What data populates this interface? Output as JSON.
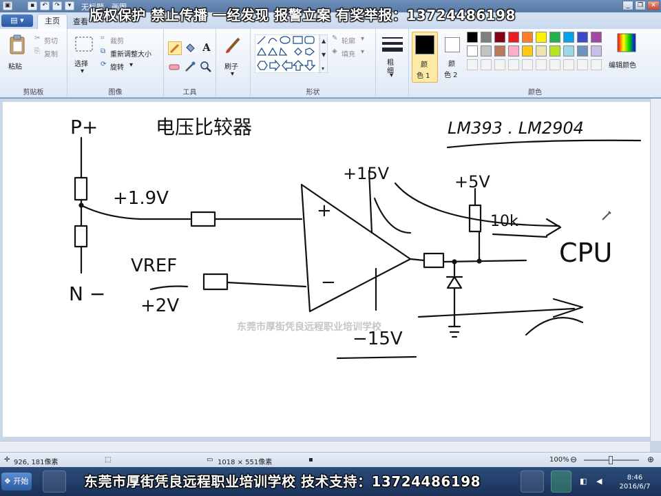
{
  "window": {
    "title": "无标题 - 画图"
  },
  "watermark": {
    "top": "版权保护  禁止传播  一经发现  报警立案  有奖举报：13724486198",
    "bottom": "东莞市厚街凭良远程职业培训学校  技术支持：13724486198",
    "center": "东莞市厚街凭良远程职业培训学校"
  },
  "tabs": {
    "menu": "▤ ▾",
    "home": "主页",
    "view": "查看"
  },
  "ribbon": {
    "clipboard": {
      "paste": "粘贴",
      "cut": "剪切",
      "copy": "复制",
      "label": "剪贴板"
    },
    "image": {
      "select": "选择",
      "crop": "裁剪",
      "resize": "重新调整大小",
      "rotate": "旋转",
      "label": "图像"
    },
    "tools": {
      "label": "工具"
    },
    "brushes": {
      "label": "刷子"
    },
    "shapes": {
      "outline": "轮廓",
      "fill": "填充",
      "label": "形状"
    },
    "size": {
      "label": "粗细"
    },
    "color1": {
      "label_top": "颜",
      "label_bottom": "色 1"
    },
    "color2": {
      "label_top": "颜",
      "label_bottom": "色 2"
    },
    "colors": {
      "label": "颜色",
      "edit": "编辑颜色",
      "color1_value": "#000000",
      "color2_value": "#ffffff",
      "palette_row1": [
        "#000000",
        "#7f7f7f",
        "#880015",
        "#ed1c24",
        "#ff7f27",
        "#fff200",
        "#22b14c",
        "#00a2e8",
        "#3f48cc",
        "#a349a4"
      ],
      "palette_row2": [
        "#ffffff",
        "#c3c3c3",
        "#b97a57",
        "#ffaec9",
        "#ffc90e",
        "#efe4b0",
        "#b5e61d",
        "#99d9ea",
        "#7092be",
        "#c8bfe7"
      ]
    }
  },
  "canvas": {
    "labels": {
      "p_plus": "P+",
      "title": "电压比较器",
      "ic_names": "LM393 . LM2904",
      "plus15_top": "+15V",
      "plus5": "+5V",
      "r10k": "10k",
      "plus19": "+1.9V",
      "plus_sign": "+",
      "minus_sign": "−",
      "cpu": "CPU",
      "vref": "VREF",
      "n_minus": "N −",
      "plus2": "+2V",
      "minus15": "−15V"
    }
  },
  "statusbar": {
    "cursor_pos": "926, 181像素",
    "image_size": "1018 × 551像素",
    "zoom": "100%"
  },
  "taskbar": {
    "start": "开始",
    "time": "8:46",
    "date": "2016/6/7"
  }
}
